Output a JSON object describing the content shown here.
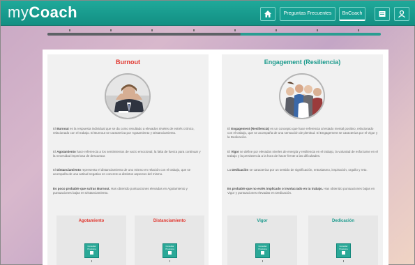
{
  "app": {
    "brand_part1": "my",
    "brand_part2": "Coach"
  },
  "nav": {
    "faq_label": "Preguntas Frecuentes",
    "burnout_label": "BnCoach"
  },
  "progress": {
    "fraction": 0.58
  },
  "left": {
    "title": "Burnout",
    "intro_bold": "Burnout",
    "intro_pre": "El",
    "intro_post": "es la respuesta individual que se da como resultado a elevados niveles de estrés crónico, relacionado con el trabajo. El Burnout se caracteriza por Agotamiento y Distanciamiento.",
    "p2_bold": "Agotamiento",
    "p2_pre": "El",
    "p2_post": "hace referencia a los sentimientos de vacío emocional, la falta de fuerza para continuar y la necesidad imperiosa de descansar.",
    "p3_bold": "Distanciamiento",
    "p3_pre": "El",
    "p3_post": "representa el distanciamiento de uno mismo en relación con el trabajo, que se acompaña de una actitud negativa en concreto a distintos aspectos del mismo.",
    "p4_bold": "Es poco probable que sufras Burnout.",
    "p4_post": "Has obtenido puntuaciones elevadas en Agotamiento y puntuaciones bajas en Distanciamiento.",
    "cards": [
      {
        "title": "Agotamiento",
        "btn": "Consultar Programa"
      },
      {
        "title": "Distanciamiento",
        "btn": "Consultar Programa"
      }
    ]
  },
  "right": {
    "title": "Engagement (Resiliencia)",
    "intro_bold": "Engagement (Resiliencia)",
    "intro_pre": "El",
    "intro_post": "es un concepto que hace referencia al estado mental positivo, relacionado con el trabajo, que se acompaña de una sensación de plenitud. El Engagement se caracteriza por el Vigor y la Dedicación.",
    "p2_bold": "Vigor",
    "p2_pre": "El",
    "p2_post": "se define por elevados niveles de energía y resiliencia en el trabajo, la voluntad de esforzarse en el trabajo y la persistencia a la hora de hacer frente a las dificultades.",
    "p3_bold": "Dedicación",
    "p3_pre": "La",
    "p3_post": "se caracteriza por un sentido de significación, entusiasmo, inspiración, orgullo y reto.",
    "p4_bold": "Es probable que no estés implicado o involucrado en tu trabajo.",
    "p4_post": "Has obtenido puntuaciones bajas en Vigor y puntuaciones elevadas en Dedicación.",
    "cards": [
      {
        "title": "Vigor",
        "btn": "Consultar Programa"
      },
      {
        "title": "Dedicación",
        "btn": "Consultar Programa"
      }
    ]
  },
  "colors": {
    "brand_teal": "#1a9a8c",
    "burnout_red": "#e0342c"
  }
}
